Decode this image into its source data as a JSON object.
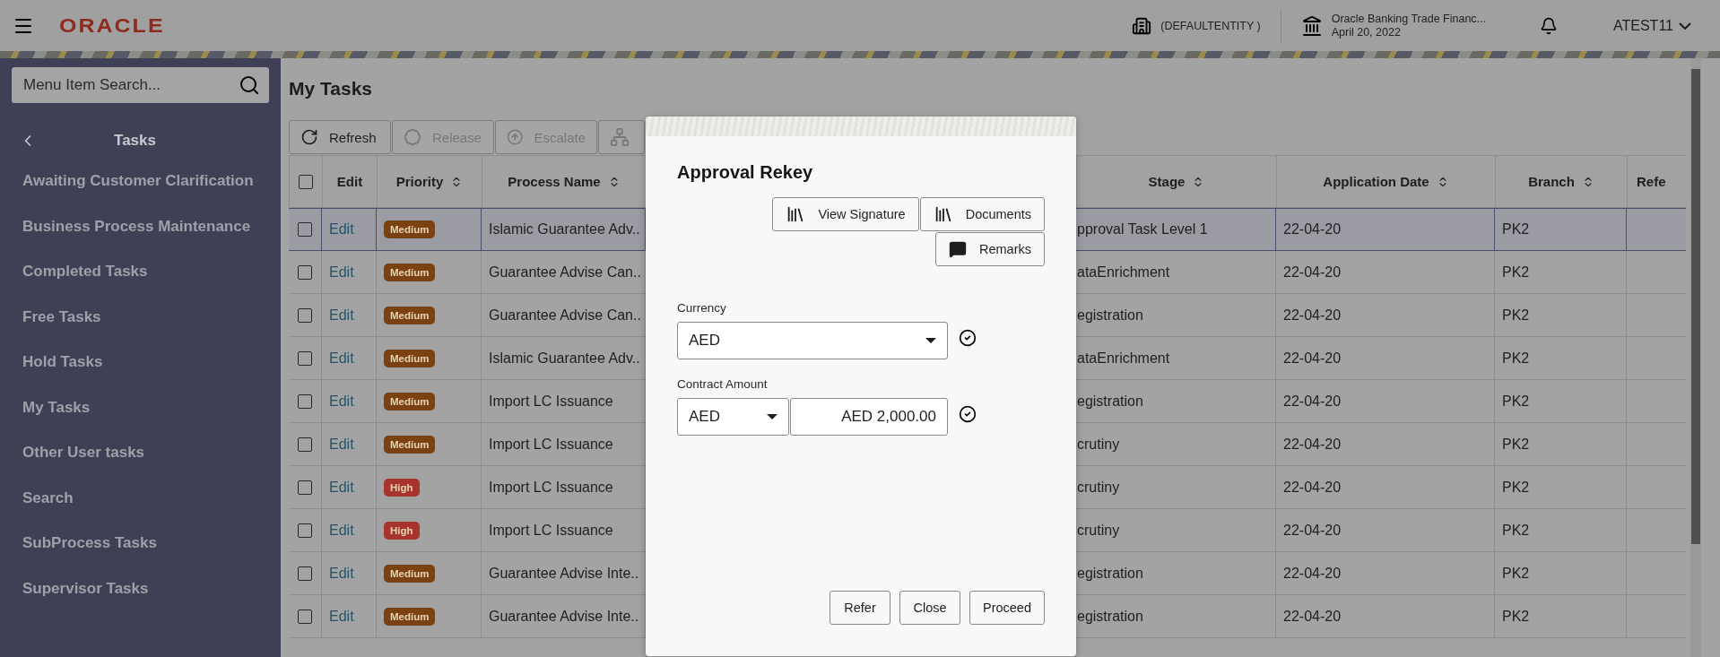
{
  "header": {
    "brand": "ORACLE",
    "entity": "(DEFAULTENTITY )",
    "app_name": "Oracle Banking Trade Financ...",
    "date": "April 20, 2022",
    "user": "ATEST11"
  },
  "sidebar": {
    "search": {
      "placeholder": "Menu Item Search..."
    },
    "title": "Tasks",
    "items": [
      {
        "label": "Awaiting Customer Clarification"
      },
      {
        "label": "Business Process Maintenance"
      },
      {
        "label": "Completed Tasks"
      },
      {
        "label": "Free Tasks"
      },
      {
        "label": "Hold Tasks"
      },
      {
        "label": "My Tasks"
      },
      {
        "label": "Other User tasks"
      },
      {
        "label": "Search"
      },
      {
        "label": "SubProcess Tasks"
      },
      {
        "label": "Supervisor Tasks"
      }
    ]
  },
  "page": {
    "title": "My Tasks",
    "toolbar": [
      {
        "kind": "refresh",
        "label": "Refresh",
        "disabled": false
      },
      {
        "kind": "release",
        "label": "Release",
        "disabled": true
      },
      {
        "kind": "escalate",
        "label": "Escalate",
        "disabled": true
      },
      {
        "kind": "hierarchy",
        "disabled": true
      }
    ]
  },
  "table": {
    "select_all_checked": false,
    "columns": [
      {
        "label": "Edit",
        "sortable": false
      },
      {
        "label": "Priority",
        "sortable": true
      },
      {
        "label": "Process Name",
        "sortable": true
      },
      {
        "label": "Stage",
        "sortable": true
      },
      {
        "label": "Application Date",
        "sortable": true
      },
      {
        "label": "Branch",
        "sortable": true
      },
      {
        "label": "Refe",
        "sortable": false
      }
    ],
    "rows": [
      {
        "checked": false,
        "selected": true,
        "edit": "Edit",
        "priority": {
          "label": "Medium",
          "color": "#7a4212"
        },
        "process": "Islamic Guarantee Adv..",
        "stage": "pproval Task Level 1",
        "date": "22-04-20",
        "branch": "PK2"
      },
      {
        "checked": false,
        "selected": false,
        "edit": "Edit",
        "priority": {
          "label": "Medium",
          "color": "#7a4212"
        },
        "process": "Guarantee Advise Can..",
        "stage": "ataEnrichment",
        "date": "22-04-20",
        "branch": "PK2"
      },
      {
        "checked": false,
        "selected": false,
        "edit": "Edit",
        "priority": {
          "label": "Medium",
          "color": "#7a4212"
        },
        "process": "Guarantee Advise Can..",
        "stage": "egistration",
        "date": "22-04-20",
        "branch": "PK2"
      },
      {
        "checked": false,
        "selected": false,
        "edit": "Edit",
        "priority": {
          "label": "Medium",
          "color": "#7a4212"
        },
        "process": "Islamic Guarantee Adv..",
        "stage": "ataEnrichment",
        "date": "22-04-20",
        "branch": "PK2"
      },
      {
        "checked": false,
        "selected": false,
        "edit": "Edit",
        "priority": {
          "label": "Medium",
          "color": "#7a4212"
        },
        "process": "Import LC Issuance",
        "stage": "egistration",
        "date": "22-04-20",
        "branch": "PK2"
      },
      {
        "checked": false,
        "selected": false,
        "edit": "Edit",
        "priority": {
          "label": "Medium",
          "color": "#7a4212"
        },
        "process": "Import LC Issuance",
        "stage": "crutiny",
        "date": "22-04-20",
        "branch": "PK2"
      },
      {
        "checked": false,
        "selected": false,
        "edit": "Edit",
        "priority": {
          "label": "High",
          "color": "#a8352b"
        },
        "process": "Import LC Issuance",
        "stage": "crutiny",
        "date": "22-04-20",
        "branch": "PK2"
      },
      {
        "checked": false,
        "selected": false,
        "edit": "Edit",
        "priority": {
          "label": "High",
          "color": "#a8352b"
        },
        "process": "Import LC Issuance",
        "stage": "crutiny",
        "date": "22-04-20",
        "branch": "PK2"
      },
      {
        "checked": false,
        "selected": false,
        "edit": "Edit",
        "priority": {
          "label": "Medium",
          "color": "#7a4212"
        },
        "process": "Guarantee Advise Inte..",
        "stage": "egistration",
        "date": "22-04-20",
        "branch": "PK2"
      },
      {
        "checked": false,
        "selected": false,
        "edit": "Edit",
        "priority": {
          "label": "Medium",
          "color": "#7a4212"
        },
        "process": "Guarantee Advise Inte..",
        "stage": "egistration",
        "date": "22-04-20",
        "branch": "PK2"
      }
    ]
  },
  "modal": {
    "title": "Approval Rekey",
    "actions": [
      {
        "kind": "books",
        "label": "View Signature"
      },
      {
        "kind": "books",
        "label": "Documents"
      },
      {
        "kind": "comment",
        "label": "Remarks"
      }
    ],
    "fields": [
      {
        "kind": "select",
        "label": "Currency",
        "value": "AED",
        "verified": true
      },
      {
        "kind": "amount",
        "label": "Contract Amount",
        "currency": "AED",
        "value": "AED 2,000.00",
        "verified": true
      }
    ],
    "buttons": [
      "Refer",
      "Close",
      "Proceed"
    ]
  }
}
